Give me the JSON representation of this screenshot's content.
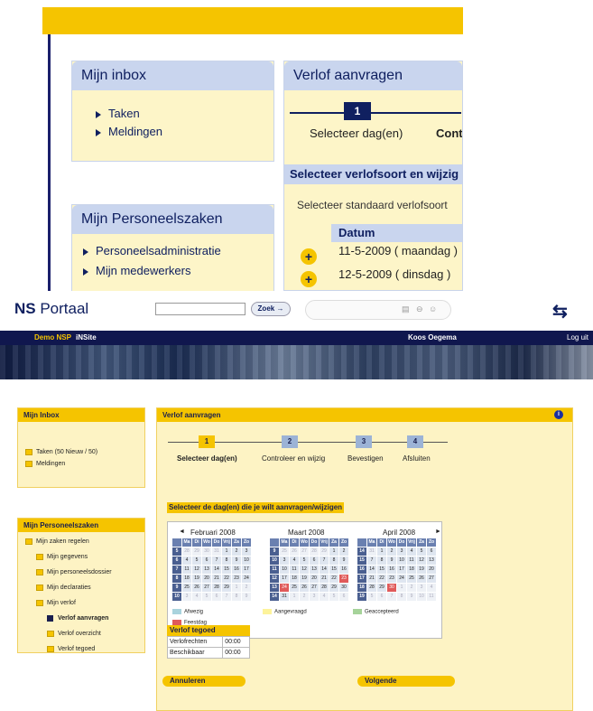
{
  "zoom": {
    "inbox": {
      "title": "Mijn inbox",
      "items": [
        "Taken",
        "Meldingen"
      ]
    },
    "personeelszaken": {
      "title": "Mijn Personeelszaken",
      "items": [
        "Personeelsadministratie",
        "Mijn medewerkers"
      ]
    },
    "verlof": {
      "title": "Verlof aanvragen",
      "step_number": "1",
      "step_label": "Selecteer dag(en)",
      "step_label_next": "Contr",
      "section_title": "Selecteer verlofsoort en wijzig",
      "standard_text": "Selecteer standaard verlofsoort",
      "column_header": "Datum",
      "rows": [
        "11-5-2009 ( maandag )",
        "12-5-2009 ( dinsdag )"
      ]
    }
  },
  "header": {
    "logo_bold": "NS",
    "logo_rest": " Portaal",
    "search_button": "Zoek",
    "ns_logo": "⇆"
  },
  "topnav": {
    "left1": "Demo NSP",
    "left2": "iNSite",
    "user": "Koos Oegema",
    "logout": "Log uit"
  },
  "inbox": {
    "title": "Mijn Inbox",
    "items": [
      "Taken  (50 Nieuw / 50)",
      "Meldingen"
    ]
  },
  "personeelszaken": {
    "title": "Mijn Personeelszaken",
    "items": [
      "Mijn zaken regelen",
      "Mijn gegevens",
      "Mijn personeelsdossier",
      "Mijn declaraties",
      "Mijn verlof",
      "Verlof aanvragen",
      "Verlof overzicht",
      "Verlof tegoed"
    ]
  },
  "verlof": {
    "title": "Verlof aanvragen",
    "info_icon": "i",
    "steps": [
      {
        "num": "1",
        "label": "Selecteer dag(en)",
        "color": "#f5c400"
      },
      {
        "num": "2",
        "label": "Controleer en wijzig",
        "color": "#9cb3d6"
      },
      {
        "num": "3",
        "label": "Bevestigen",
        "color": "#9cb3d6"
      },
      {
        "num": "4",
        "label": "Afsluiten",
        "color": "#9cb3d6"
      }
    ],
    "select_title": "Selecteer de dag(en) die je wilt aanvragen/wijzigen",
    "calendar": {
      "nav_prev": "◄",
      "nav_next": "►",
      "weekdays": [
        "Ma",
        "Di",
        "Wo",
        "Do",
        "Vrij",
        "Za",
        "Zo"
      ],
      "months": [
        {
          "name": "Februari 2008",
          "weeks": [
            [
              "5",
              "28",
              "29",
              "30",
              "31",
              "1",
              "2",
              "3"
            ],
            [
              "6",
              "4",
              "5",
              "6",
              "7",
              "8",
              "9",
              "10"
            ],
            [
              "7",
              "11",
              "12",
              "13",
              "14",
              "15",
              "16",
              "17"
            ],
            [
              "8",
              "18",
              "19",
              "20",
              "21",
              "22",
              "23",
              "24"
            ],
            [
              "9",
              "25",
              "26",
              "27",
              "28",
              "29",
              "1",
              "2"
            ],
            [
              "10",
              "3",
              "4",
              "5",
              "6",
              "7",
              "8",
              "9"
            ]
          ]
        },
        {
          "name": "Maart 2008",
          "weeks": [
            [
              "9",
              "25",
              "26",
              "27",
              "28",
              "29",
              "1",
              "2"
            ],
            [
              "10",
              "3",
              "4",
              "5",
              "6",
              "7",
              "8",
              "9"
            ],
            [
              "11",
              "10",
              "11",
              "12",
              "13",
              "14",
              "15",
              "16"
            ],
            [
              "12",
              "17",
              "18",
              "19",
              "20",
              "21",
              "22",
              "23"
            ],
            [
              "13",
              "24",
              "25",
              "26",
              "27",
              "28",
              "29",
              "30"
            ],
            [
              "14",
              "31",
              "1",
              "2",
              "3",
              "4",
              "5",
              "6"
            ]
          ]
        },
        {
          "name": "April 2008",
          "weeks": [
            [
              "14",
              "31",
              "1",
              "2",
              "3",
              "4",
              "5",
              "6"
            ],
            [
              "15",
              "7",
              "8",
              "9",
              "10",
              "11",
              "12",
              "13"
            ],
            [
              "16",
              "14",
              "15",
              "16",
              "17",
              "18",
              "19",
              "20"
            ],
            [
              "17",
              "21",
              "22",
              "23",
              "24",
              "25",
              "26",
              "27"
            ],
            [
              "18",
              "28",
              "29",
              "30",
              "1",
              "2",
              "3",
              "4"
            ],
            [
              "19",
              "5",
              "6",
              "7",
              "8",
              "9",
              "10",
              "11"
            ]
          ]
        }
      ],
      "legend": [
        {
          "label": "Afwezig",
          "color": "#a9d3dd"
        },
        {
          "label": "Aangevraagd",
          "color": "#fdf39b"
        },
        {
          "label": "Geaccepteerd",
          "color": "#a6d39a"
        },
        {
          "label": "Feestdag",
          "color": "#e05a5a"
        }
      ]
    },
    "tegoed": {
      "title": "Verlof tegoed",
      "rows": [
        {
          "label": "Verlofrechten",
          "value": "00:00"
        },
        {
          "label": "Beschikbaar",
          "value": "00:00"
        }
      ]
    },
    "cancel_button": "Annuleren",
    "next_button": "Volgende"
  }
}
